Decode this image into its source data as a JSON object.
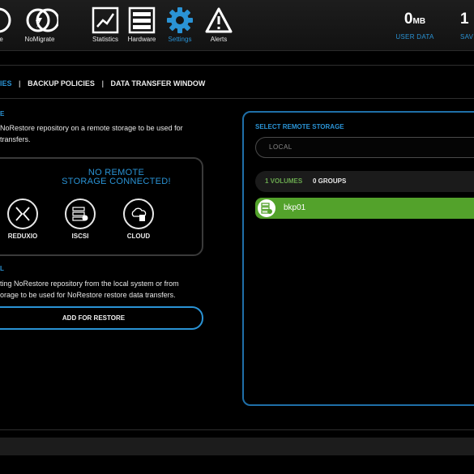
{
  "nav": {
    "items": [
      {
        "label": "ore",
        "icon": "restore-icon"
      },
      {
        "label": "NoMigrate",
        "icon": "nomigrate-icon"
      },
      {
        "label": "Statistics",
        "icon": "statistics-icon"
      },
      {
        "label": "Hardware",
        "icon": "hardware-icon"
      },
      {
        "label": "Settings",
        "icon": "gear-icon",
        "active": true
      },
      {
        "label": "Alerts",
        "icon": "alert-icon"
      }
    ],
    "stats": [
      {
        "value": "0",
        "unit": "MB",
        "caption": "USER DATA"
      },
      {
        "value": "1",
        "unit": "",
        "caption": "SAV"
      }
    ]
  },
  "tabs": {
    "active": "IES",
    "items": [
      "BACKUP POLICIES",
      "DATA TRANSFER WINDOW"
    ],
    "separator": "|"
  },
  "left": {
    "section1_heading": "E",
    "section1_desc_line1": "NoRestore repository on a remote storage to be used for",
    "section1_desc_line2": "transfers.",
    "no_remote_line1": "NO REMOTE",
    "no_remote_line2": "STORAGE CONNECTED!",
    "options": [
      {
        "label": "REDUXIO",
        "icon": "reduxio-icon"
      },
      {
        "label": "ISCSI",
        "icon": "iscsi-icon"
      },
      {
        "label": "CLOUD",
        "icon": "cloud-icon"
      }
    ],
    "section2_heading": "L",
    "section2_desc_line1": "ting NoRestore repository from the local system or from",
    "section2_desc_line2": "orage to be used for NoRestore restore data transfers.",
    "add_button": "ADD FOR RESTORE"
  },
  "right": {
    "heading": "SELECT REMOTE STORAGE",
    "search_value": "LOCAL",
    "volumes_count": "1 VOLUMES",
    "groups_count": "0 GROUPS",
    "volume_name": "bkp01"
  },
  "colors": {
    "accent": "#2a93d5",
    "volume_green": "#53a22b",
    "count_green": "#6aa84f"
  }
}
